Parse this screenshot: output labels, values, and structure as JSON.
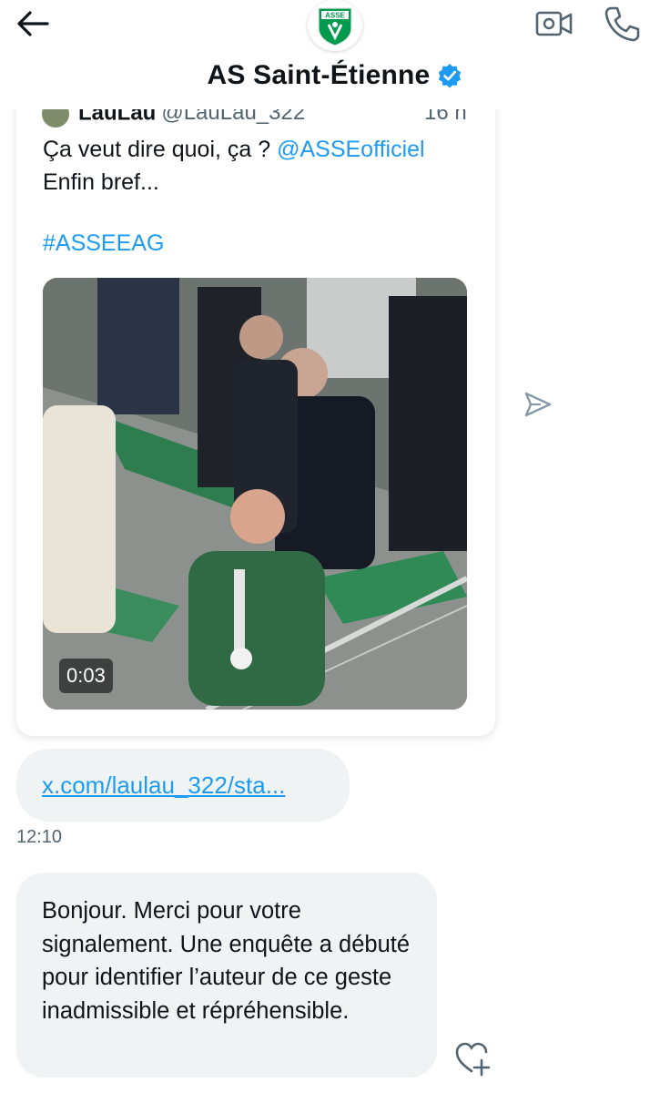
{
  "header": {
    "contact_name": "AS Saint-Étienne",
    "verified": true,
    "avatar_text": "ASSE",
    "accent_color": "#1d9bf0",
    "club_green": "#009a4e"
  },
  "quoted_tweet": {
    "author_name": "LauLau",
    "author_handle": "@LauLau_322",
    "time": "16 h",
    "text_line1": "Ça veut dire quoi, ça ?",
    "mention": "@ASSEofficiel",
    "text_line2": "Enfin bref...",
    "hashtag": "#ASSEEAG",
    "video_duration": "0:03"
  },
  "link_message": {
    "url_text": "x.com/laulau_322/sta..."
  },
  "link_timestamp": "12:10",
  "reply_message": {
    "text": "Bonjour. Merci pour votre signalement. Une enquête a débuté pour identifier l’auteur de ce geste inadmissible et répréhensible."
  },
  "icons": {
    "back": "arrow-left-icon",
    "video_call": "video-camera-icon",
    "voice_call": "phone-icon",
    "verified": "verified-badge-icon",
    "share": "send-icon",
    "react": "heart-plus-icon"
  }
}
